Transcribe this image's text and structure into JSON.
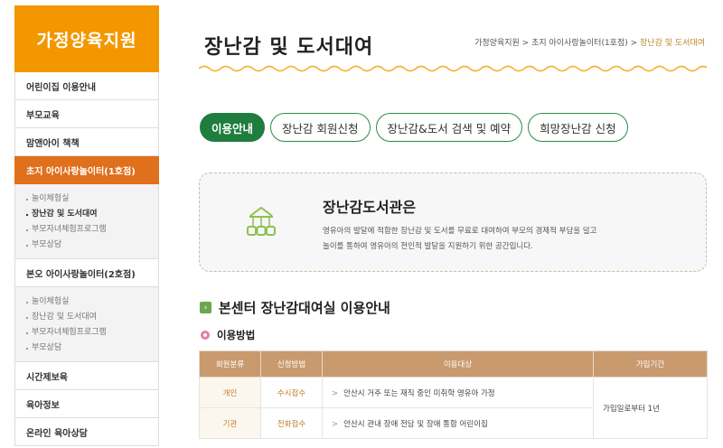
{
  "sidebar": {
    "title": "가정양육지원",
    "items": [
      {
        "label": "어린이집 이용안내"
      },
      {
        "label": "부모교육"
      },
      {
        "label": "맘앤아이 책책"
      },
      {
        "label": "초지 아이사랑놀이터(1호점)",
        "active": true
      },
      {
        "label": "본오 아이사랑놀이터(2호점)"
      },
      {
        "label": "시간제보육"
      },
      {
        "label": "육아정보"
      },
      {
        "label": "온라인 육아상담"
      }
    ],
    "sub1": [
      "놀이체험실",
      "장난감 및 도서대여",
      "부모자녀체험프로그램",
      "부모상담"
    ],
    "sub2": [
      "놀이체험실",
      "장난감 및 도서대여",
      "부모자녀체험프로그램",
      "부모상담"
    ]
  },
  "header": {
    "title": "장난감 및 도서대여",
    "breadcrumb": [
      "가정양육지원",
      "초지 아이사랑놀이터(1호점)",
      "장난감 및 도서대여"
    ],
    "sep": " > "
  },
  "tabs": [
    {
      "label": "이용안내",
      "active": true
    },
    {
      "label": "장난감 회원신청"
    },
    {
      "label": "장난감&도서 검색 및 예약"
    },
    {
      "label": "희망장난감 신청"
    }
  ],
  "info": {
    "title": "장난감도서관은",
    "desc1": "영유아의 발달에 적합한 장난감 및 도서를 무료로 대여하여 부모의 경제적 부담을 덜고",
    "desc2": "놀이를 통하여 영유아의 전인적 발달을 지원하기 위한 공간입니다."
  },
  "section": {
    "title": "본센터 장난감대여실 이용안내",
    "sub_title": "이용방법",
    "mark": "›"
  },
  "table": {
    "headers": [
      "회원분류",
      "신청방법",
      "이용대상",
      "가입기간"
    ],
    "rows": [
      {
        "type": "개인",
        "method": "수시접수",
        "target": "안산시 거주 또는 재직 중인 미취학 영유아 가정"
      },
      {
        "type": "기관",
        "method": "전화접수",
        "target": "안산시 관내 장애 전담 및 장애 통합 어린이집"
      }
    ],
    "period": "가입일로부터 1년",
    "arrow": ">"
  },
  "colors": {
    "brand_orange": "#f39700",
    "active_orange": "#e0701b",
    "green": "#1f7d3e",
    "table_header": "#c89a6e"
  },
  "icons": {
    "info": "toy-library-icon",
    "section": "chevron-right-icon",
    "sub": "bullet-circle-icon"
  }
}
